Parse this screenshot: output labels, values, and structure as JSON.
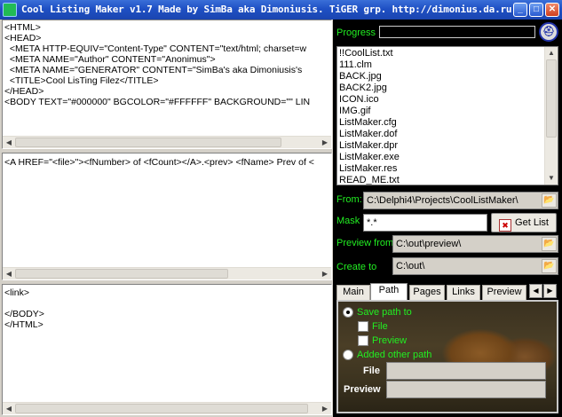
{
  "window": {
    "title": "Cool Listing Maker v1.7 Made by SimBa aka Dimoniusis. TiGER grp. http://dimonius.da.ru",
    "minimize_glyph": "_",
    "maximize_glyph": "□",
    "close_glyph": "✕"
  },
  "editors": {
    "header_text": "<HTML>\n<HEAD>\n  <META HTTP-EQUIV=\"Content-Type\" CONTENT=\"text/html; charset=w\n  <META NAME=\"Author\" CONTENT=\"Anonimus\">\n  <META NAME=\"GENERATOR\" CONTENT=\"SimBa's aka Dimoniusis's\n  <TITLE>Cool LisTing Filez</TITLE>\n</HEAD>\n<BODY TEXT=\"#000000\" BGCOLOR=\"#FFFFFF\" BACKGROUND=\"\" LIN",
    "body_text": "<A HREF=\"<file>\"><fNumber> of <fCount></A>.<prev> <fName> Prev of <",
    "footer_text": "<link>\n\n</BODY>\n</HTML>"
  },
  "progress": {
    "label": "Progress",
    "value": 0
  },
  "help_icon": "help-lifebuoy-icon",
  "files": [
    "!!CoolList.txt",
    "111.clm",
    "BACK.jpg",
    "BACK2.jpg",
    "ICON.ico",
    "IMG.gif",
    "ListMaker.cfg",
    "ListMaker.dof",
    "ListMaker.dpr",
    "ListMaker.exe",
    "ListMaker.res",
    "READ_ME.txt"
  ],
  "form": {
    "from_label": "From:",
    "from_value": "C:\\Delphi4\\Projects\\CoolListMaker\\",
    "mask_label": "Mask",
    "mask_value": "*.*",
    "get_list_label": "Get List",
    "preview_from_label": "Preview from",
    "preview_from_value": "C:\\out\\preview\\",
    "create_to_label": "Create to",
    "create_to_value": "C:\\out\\"
  },
  "tabs": [
    "Main",
    "Path",
    "Pages",
    "Links",
    "Preview"
  ],
  "active_tab": "Path",
  "path_tab": {
    "save_path_label": "Save path to",
    "file_check_label": "File",
    "preview_check_label": "Preview",
    "added_other_label": "Added other path",
    "file_field_label": "File",
    "preview_field_label": "Preview",
    "file_field_value": "",
    "preview_field_value": ""
  },
  "colors": {
    "green_label": "#22ee22",
    "title_bar": "#1f50c4",
    "right_panel_bg": "#000000"
  }
}
